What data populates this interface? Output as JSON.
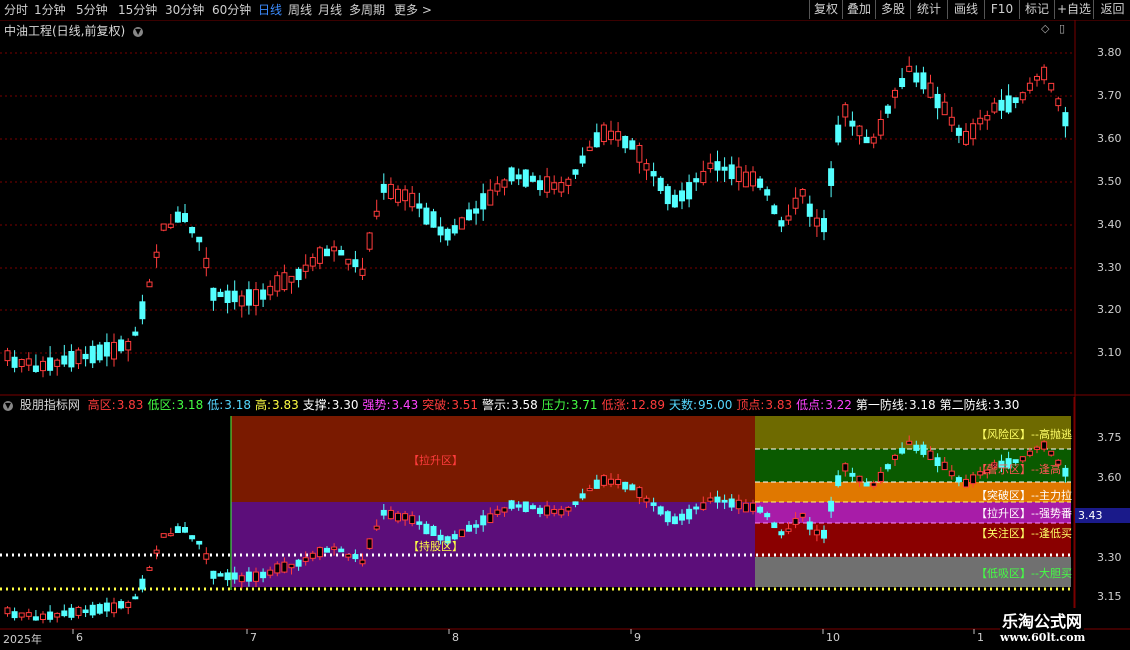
{
  "toolbar": {
    "periods": [
      "分时",
      "1分钟",
      "5分钟",
      "15分钟",
      "30分钟",
      "60分钟",
      "日线",
      "周线",
      "月线",
      "多周期",
      "更多 >"
    ],
    "active_period": "日线",
    "right_buttons": [
      "复权",
      "叠加",
      "多股",
      "统计",
      "画线",
      "F10",
      "标记",
      "+自选",
      "返回"
    ]
  },
  "main_chart": {
    "title": "中油工程(日线,前复权)",
    "price_axis": [
      "3.80",
      "3.70",
      "3.60",
      "3.50",
      "3.40",
      "3.30",
      "3.20",
      "3.10"
    ]
  },
  "indicator": {
    "name": "股朋指标网",
    "values": [
      {
        "label": "高区:",
        "value": "3.83",
        "color": "#ff3c3c"
      },
      {
        "label": "低区:",
        "value": "3.18",
        "color": "#44ff44"
      },
      {
        "label": "低:",
        "value": "3.18",
        "color": "#56d8ff"
      },
      {
        "label": "高:",
        "value": "3.83",
        "color": "#ffff44"
      },
      {
        "label": "支撑:",
        "value": "3.30",
        "color": "#ffffff"
      },
      {
        "label": "强势:",
        "value": "3.43",
        "color": "#ff44ff"
      },
      {
        "label": "突破:",
        "value": "3.51",
        "color": "#ff3c3c"
      },
      {
        "label": "警示:",
        "value": "3.58",
        "color": "#ffffff"
      },
      {
        "label": "压力:",
        "value": "3.71",
        "color": "#44ff44"
      },
      {
        "label": "低涨:",
        "value": "12.89",
        "color": "#ff3c3c"
      },
      {
        "label": "天数:",
        "value": "95.00",
        "color": "#56d8ff"
      },
      {
        "label": "顶点:",
        "value": "3.83",
        "color": "#ff3c3c"
      },
      {
        "label": "低点:",
        "value": "3.22",
        "color": "#ff44ff"
      },
      {
        "label": "第一防线:",
        "value": "3.18",
        "color": "#ffffff"
      },
      {
        "label": "第二防线:",
        "value": "3.30",
        "color": "#ffffff"
      }
    ],
    "price_axis": [
      "3.75",
      "3.60",
      "3.30",
      "3.15"
    ],
    "current_price_tag": "3.43",
    "zones_left": [
      "【拉升区】",
      "【持股区】"
    ],
    "zones_right": [
      {
        "text": "【风险区】--高抛逃",
        "color": "#ffff66"
      },
      {
        "text": "【警示区】--逢高",
        "color": "#ff5555"
      },
      {
        "text": "【突破区】--主力拉",
        "color": "#ffffff"
      },
      {
        "text": "【拉升区】--强势番",
        "color": "#ffffff"
      },
      {
        "text": "【关注区】--逢低买",
        "color": "#ffff66"
      },
      {
        "text": "【低吸区】--大胆买",
        "color": "#44ff44"
      }
    ]
  },
  "x_axis": {
    "labels": [
      "2025年",
      "6",
      "7",
      "8",
      "9",
      "10",
      "1"
    ]
  },
  "watermark": {
    "line1": "乐淘公式网",
    "line2": "www.60lt.com"
  },
  "colors": {
    "up": "#ff3c3c",
    "down": "#54ffff",
    "grid": "#7a0000",
    "bg": "#000000",
    "active": "#3c8cff"
  }
}
